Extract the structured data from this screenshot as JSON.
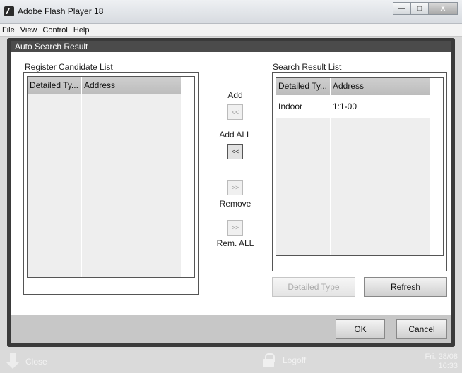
{
  "window": {
    "title": "Adobe Flash Player 18",
    "minimize_glyph": "—",
    "maximize_glyph": "□",
    "close_glyph": "X"
  },
  "menu": [
    "File",
    "View",
    "Control",
    "Help"
  ],
  "dialog": {
    "title": "Auto Search Result",
    "register_list": {
      "label": "Register Candidate List",
      "columns": [
        "Detailed Ty...",
        "Address"
      ],
      "rows": [
        [
          "",
          ""
        ],
        [
          "",
          ""
        ],
        [
          "",
          ""
        ],
        [
          "",
          ""
        ],
        [
          "",
          ""
        ],
        [
          "",
          ""
        ],
        [
          "",
          ""
        ],
        [
          "",
          ""
        ]
      ]
    },
    "result_list": {
      "label": "Search Result List",
      "columns": [
        "Detailed Ty...",
        "Address"
      ],
      "rows": [
        [
          "Indoor",
          "1:1-00"
        ],
        [
          "",
          ""
        ],
        [
          "",
          ""
        ],
        [
          "",
          ""
        ],
        [
          "",
          ""
        ],
        [
          "",
          ""
        ],
        [
          "",
          ""
        ]
      ]
    },
    "actions": {
      "add_label": "Add",
      "add_glyph": "<<",
      "add_all_label": "Add ALL",
      "add_all_glyph": "<<",
      "remove_glyph": ">>",
      "remove_label": "Remove",
      "remove_all_glyph": ">>",
      "remove_all_label": "Rem. ALL"
    },
    "detailed_type_button": "Detailed Type",
    "refresh_button": "Refresh",
    "ok_button": "OK",
    "cancel_button": "Cancel"
  },
  "taskbar": {
    "close_label": "Close",
    "logoff_label": "Logoff",
    "date": "Fri. 28/08",
    "time": "16:33"
  },
  "colors": {
    "dialog_frame": "#3a3a3a",
    "dialog_title_bar": "#4b4b4b",
    "list_header": "#c6c6c6",
    "row_stripe": "#eeeeee",
    "footer": "#c7c7c7"
  },
  "icons": {
    "app": "flash-player-icon",
    "close_task": "down-arrow-icon",
    "logoff": "lock-icon"
  }
}
